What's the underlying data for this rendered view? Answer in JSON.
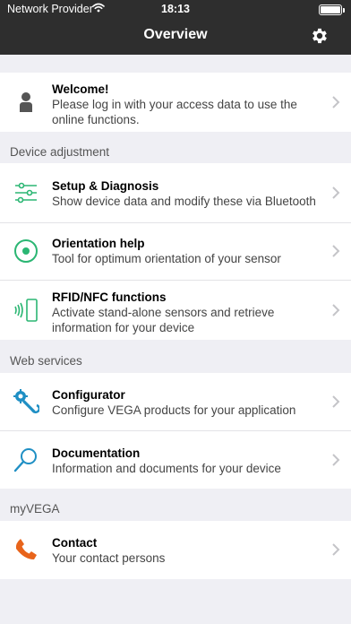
{
  "status_bar": {
    "provider": "Network Provider",
    "time": "18:13"
  },
  "nav": {
    "title": "Overview"
  },
  "welcome": {
    "title": "Welcome!",
    "subtitle": "Please log in with your access data to use the online functions."
  },
  "sections": {
    "device_adjustment": "Device adjustment",
    "web_services": "Web services",
    "myvega": "myVEGA"
  },
  "items": {
    "setup": {
      "title": "Setup & Diagnosis",
      "subtitle": "Show device data and modify these via Bluetooth"
    },
    "orientation": {
      "title": "Orientation help",
      "subtitle": "Tool for optimum orientation of your sensor"
    },
    "rfid": {
      "title": "RFID/NFC functions",
      "subtitle": "Activate stand-alone sensors and retrieve information for your device"
    },
    "configurator": {
      "title": "Configurator",
      "subtitle": "Configure VEGA products for your application"
    },
    "documentation": {
      "title": "Documentation",
      "subtitle": "Information and documents for your device"
    },
    "contact": {
      "title": "Contact",
      "subtitle": "Your contact persons"
    }
  },
  "colors": {
    "green": "#2bb673",
    "blue": "#1f8fc4",
    "orange": "#e8641b",
    "gray_icon": "#555555",
    "chevron": "#c4c4c8"
  },
  "icons": {
    "welcome": "person-icon",
    "setup": "sliders-icon",
    "orientation": "target-icon",
    "rfid": "nfc-phone-icon",
    "configurator": "wrench-gear-icon",
    "documentation": "magnifier-icon",
    "contact": "phone-icon",
    "settings": "gear-icon"
  }
}
